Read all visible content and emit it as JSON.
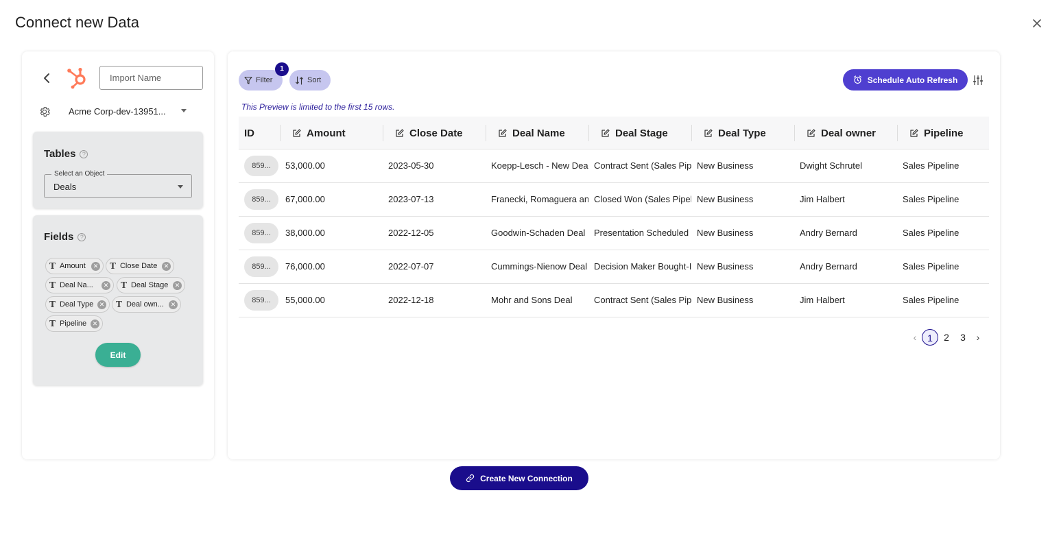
{
  "header": {
    "title": "Connect new Data"
  },
  "left": {
    "import_name_placeholder": "Import Name",
    "account": "Acme Corp-dev-13951...",
    "tables": {
      "title": "Tables",
      "select_label": "Select an Object",
      "select_value": "Deals"
    },
    "fields": {
      "title": "Fields",
      "chips": [
        "Amount",
        "Close Date",
        "Deal Na...",
        "Deal Stage",
        "Deal Type",
        "Deal own...",
        "Pipeline"
      ],
      "edit_label": "Edit"
    }
  },
  "toolbar": {
    "filter_label": "Filter",
    "filter_count": "1",
    "sort_label": "Sort",
    "schedule_label": "Schedule Auto Refresh"
  },
  "preview_note": "This Preview is limited to the first 15 rows.",
  "table": {
    "columns": [
      "ID",
      "Amount",
      "Close Date",
      "Deal Name",
      "Deal Stage",
      "Deal Type",
      "Deal owner",
      "Pipeline"
    ],
    "rows": [
      [
        "859...",
        "53,000.00",
        "2023-05-30",
        "Koepp-Lesch - New Deal",
        "Contract Sent (Sales Pipeline)",
        "New Business",
        "Dwight Schrutel",
        "Sales Pipeline"
      ],
      [
        "859...",
        "67,000.00",
        "2023-07-13",
        "Franecki, Romaguera and",
        "Closed Won (Sales Pipeline)",
        "New Business",
        "Jim Halbert",
        "Sales Pipeline"
      ],
      [
        "859...",
        "38,000.00",
        "2022-12-05",
        "Goodwin-Schaden Deal",
        "Presentation Scheduled",
        "New Business",
        "Andry Bernard",
        "Sales Pipeline"
      ],
      [
        "859...",
        "76,000.00",
        "2022-07-07",
        "Cummings-Nienow Deal",
        "Decision Maker Bought-In",
        "New Business",
        "Andry Bernard",
        "Sales Pipeline"
      ],
      [
        "859...",
        "55,000.00",
        "2022-12-18",
        "Mohr and Sons Deal",
        "Contract Sent (Sales Pipeline)",
        "New Business",
        "Jim Halbert",
        "Sales Pipeline"
      ]
    ]
  },
  "pagination": {
    "pages": [
      "1",
      "2",
      "3"
    ],
    "current": "1"
  },
  "footer": {
    "create_label": "Create New Connection"
  },
  "colors": {
    "primary": "#1a0d8c",
    "accent": "#4f3fd0",
    "edit": "#3aaf94",
    "pill": "#c6c6ef",
    "hubspot": "#ff7a59"
  }
}
